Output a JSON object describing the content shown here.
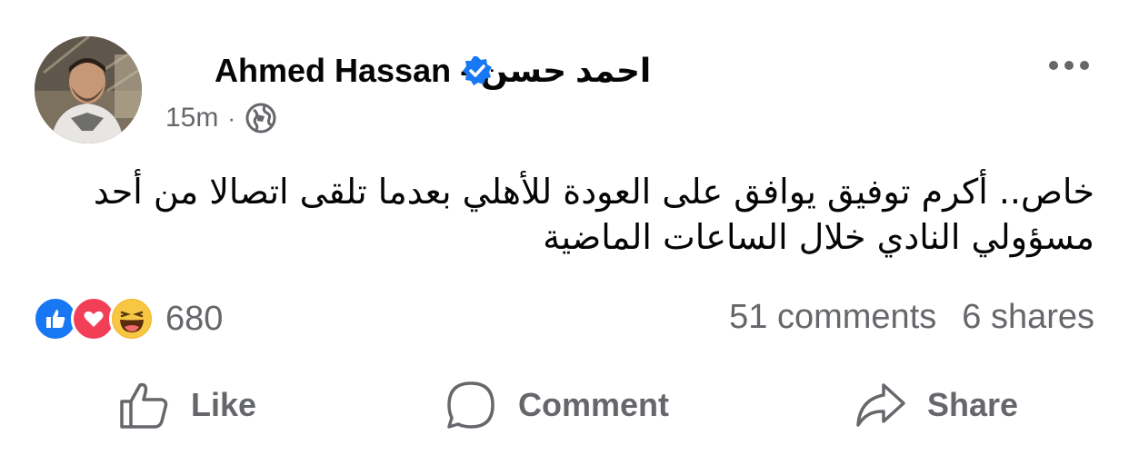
{
  "post": {
    "author_name": "Ahmed Hassan - احمد حسن",
    "verified_icon": "verified-badge-icon",
    "timestamp": "15m",
    "separator": "·",
    "audience_icon": "globe-icon",
    "text": "خاص.. أكرم توفيق يوافق على العودة للأهلي بعدما تلقى اتصالا من أحد مسؤولي النادي خلال الساعات الماضية"
  },
  "reactions": {
    "icons": [
      "like-icon",
      "love-icon",
      "haha-icon"
    ],
    "count": "680",
    "comments": "51 comments",
    "shares": "6 shares"
  },
  "actions": {
    "like_label": "Like",
    "comment_label": "Comment",
    "share_label": "Share"
  },
  "colors": {
    "accent": "#1877f2",
    "love": "#f33e58",
    "haha": "#f7b125",
    "muted": "#65676b"
  }
}
